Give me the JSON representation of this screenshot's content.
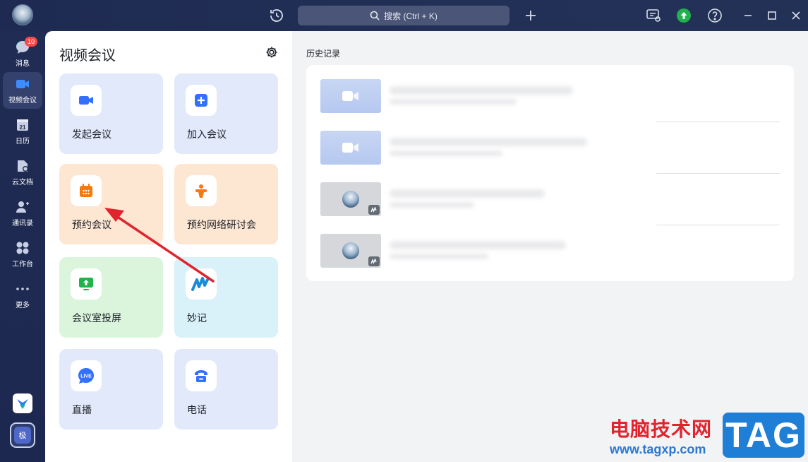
{
  "topbar": {
    "search_placeholder": "搜索 (Ctrl + K)"
  },
  "nav": {
    "items": [
      {
        "label": "消息",
        "badge": "10",
        "icon": "message-icon"
      },
      {
        "label": "视频会议",
        "icon": "video-meeting-icon",
        "active": true
      },
      {
        "label": "日历",
        "icon": "calendar-icon",
        "date": "21"
      },
      {
        "label": "云文档",
        "icon": "cloud-doc-icon"
      },
      {
        "label": "通讯录",
        "icon": "contacts-icon"
      },
      {
        "label": "工作台",
        "icon": "workbench-icon"
      },
      {
        "label": "更多",
        "icon": "more-icon"
      }
    ],
    "user_initial": "极"
  },
  "panel": {
    "title": "视频会议",
    "cards": [
      {
        "label": "发起会议",
        "icon": "start-meeting-icon",
        "color": "#e1e9fb"
      },
      {
        "label": "加入会议",
        "icon": "join-meeting-icon",
        "color": "#e1e9fb"
      },
      {
        "label": "预约会议",
        "icon": "schedule-meeting-icon",
        "color": "#fde6d2"
      },
      {
        "label": "预约网络研讨会",
        "icon": "webinar-icon",
        "color": "#fde6d2"
      },
      {
        "label": "会议室投屏",
        "icon": "screen-cast-icon",
        "color": "#dbf5dc"
      },
      {
        "label": "妙记",
        "icon": "minutes-icon",
        "color": "#d9f1f9"
      },
      {
        "label": "直播",
        "icon": "live-icon",
        "color": "#e1e9fb"
      },
      {
        "label": "电话",
        "icon": "phone-icon",
        "color": "#e1e9fb"
      }
    ]
  },
  "history": {
    "title": "历史记录",
    "rows": [
      {
        "thumb": "video"
      },
      {
        "thumb": "video"
      },
      {
        "thumb": "photo"
      },
      {
        "thumb": "photo"
      }
    ]
  },
  "watermark": {
    "site_name": "电脑技术网",
    "url": "www.tagxp.com",
    "tag": "TAG"
  },
  "colors": {
    "accent": "#3370ff",
    "nav_bg": "#1f2a4d",
    "badge": "#f54a45",
    "arrow": "#e0232d"
  }
}
